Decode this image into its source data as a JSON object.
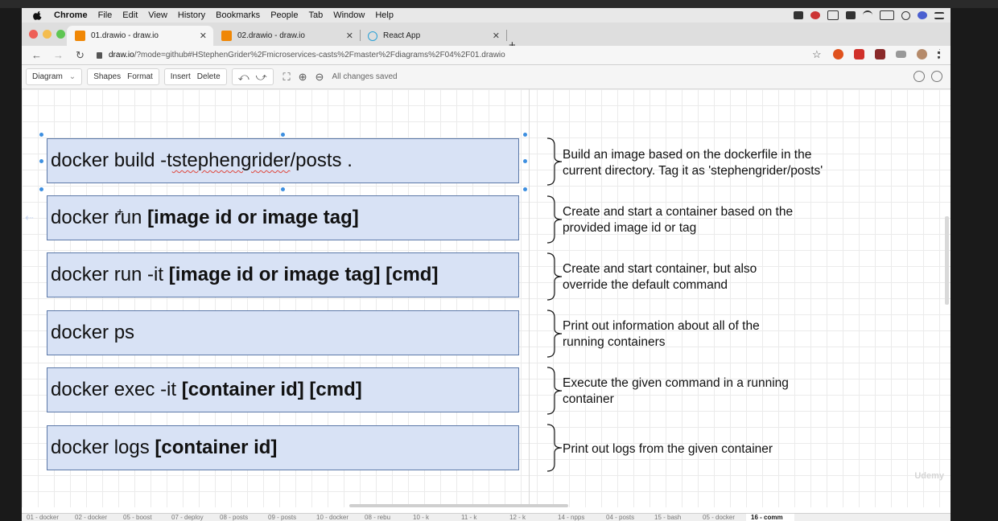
{
  "menubar": {
    "app": "Chrome",
    "items": [
      "File",
      "Edit",
      "View",
      "History",
      "Bookmarks",
      "People",
      "Tab",
      "Window",
      "Help"
    ]
  },
  "tabs": [
    {
      "title": "01.drawio - draw.io",
      "icon": "drawio-icon",
      "active": true
    },
    {
      "title": "02.drawio - draw.io",
      "icon": "drawio-icon",
      "active": false
    },
    {
      "title": "React App",
      "icon": "react-icon",
      "active": false
    }
  ],
  "address": {
    "host": "draw.io",
    "path": "/?mode=github#HStephenGrider%2Fmicroservices-casts%2Fmaster%2Fdiagrams%2F04%2F01.drawio"
  },
  "toolbar": {
    "diagram": "Diagram",
    "shapes": "Shapes",
    "format": "Format",
    "insert": "Insert",
    "delete": "Delete",
    "status": "All changes saved"
  },
  "commands": [
    {
      "plain": "docker build -t ",
      "squiggle": "stephengrider",
      "after": "/posts .",
      "bold": ""
    },
    {
      "plain": "docker run ",
      "squiggle": "",
      "after": "",
      "bold": "[image id or image tag]"
    },
    {
      "plain": "docker run -it ",
      "squiggle": "",
      "after": "",
      "bold": "[image id or image tag] [cmd]"
    },
    {
      "plain": "docker ps",
      "squiggle": "",
      "after": "",
      "bold": ""
    },
    {
      "plain": "docker exec -it ",
      "squiggle": "",
      "after": "",
      "bold": "[container id] [cmd]"
    },
    {
      "plain": "docker logs ",
      "squiggle": "",
      "after": "",
      "bold": "[container id]"
    }
  ],
  "descriptions": [
    [
      "Build an image based on the dockerfile in the",
      "current directory.  Tag it as 'stephengrider/posts'"
    ],
    [
      "Create and start a container based on the",
      "provided image id or tag"
    ],
    [
      "Create and start container, but also",
      "override the default command"
    ],
    [
      "Print out information about all of the",
      "running containers"
    ],
    [
      "Execute the given command in a running",
      "container"
    ],
    [
      "Print out logs from the given container"
    ]
  ],
  "watermark": "Udemy",
  "page_tabs": [
    "01 - docker",
    "02 - docker",
    "05 - boost",
    "07 - deploy",
    "08 - posts",
    "09 - posts",
    "10 - docker",
    "08 - rebu",
    "10 - k",
    "11 - k",
    "12 - k",
    "14 - npps",
    "04 - posts",
    "15 - bash",
    "05 - docker",
    "16 - comm"
  ],
  "colors": {
    "box_fill": "#d8e2f5",
    "box_border": "#5b78a8",
    "handle": "#3d8fe0"
  }
}
